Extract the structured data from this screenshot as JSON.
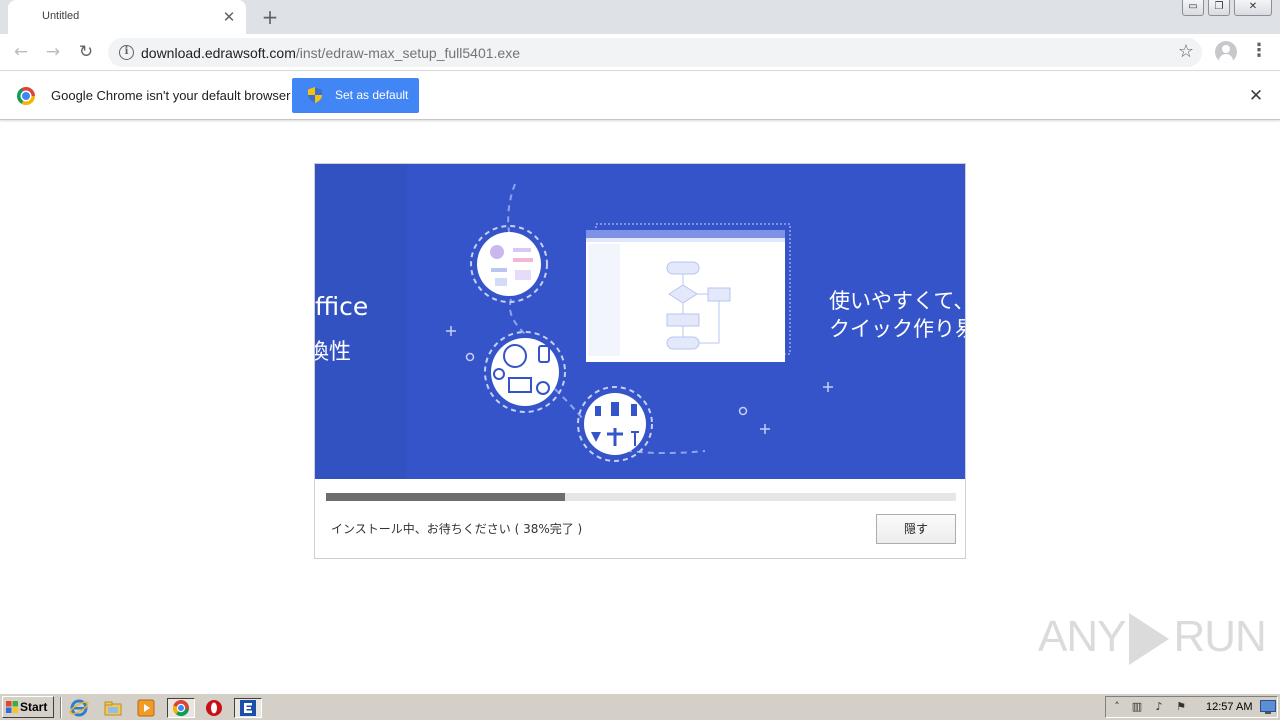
{
  "browser": {
    "tab": {
      "title": "Untitled",
      "close": "✕"
    },
    "new_tab": "+",
    "window_controls": {
      "minimize": "▭",
      "restore": "❐",
      "close": "✕"
    },
    "url": {
      "host": "download.edrawsoft.com",
      "path": "/inst/edraw-max_setup_full5401.exe"
    },
    "infobar": {
      "message": "Google Chrome isn't your default browser",
      "button_label": "Set as default",
      "close": "✕"
    }
  },
  "installer": {
    "banner": {
      "left_line1": "ffice",
      "left_line2": "換性",
      "right_line1": "使いやすくて、",
      "right_line2": "クイック作り易"
    },
    "progress_percent": 38,
    "status_text": "インストール中、お待ちください ( 38%完了 )",
    "hide_button": "隠す",
    "colors": {
      "banner_bg": "#3554c9",
      "progress_fill": "#6d6d6d"
    }
  },
  "watermark": {
    "left": "ANY",
    "right": "RUN"
  },
  "taskbar": {
    "start_label": "Start",
    "clock": "12:57 AM",
    "icons": [
      "ie-icon",
      "explorer-icon",
      "media-player-icon",
      "chrome-icon",
      "opera-icon",
      "edraw-icon"
    ]
  }
}
